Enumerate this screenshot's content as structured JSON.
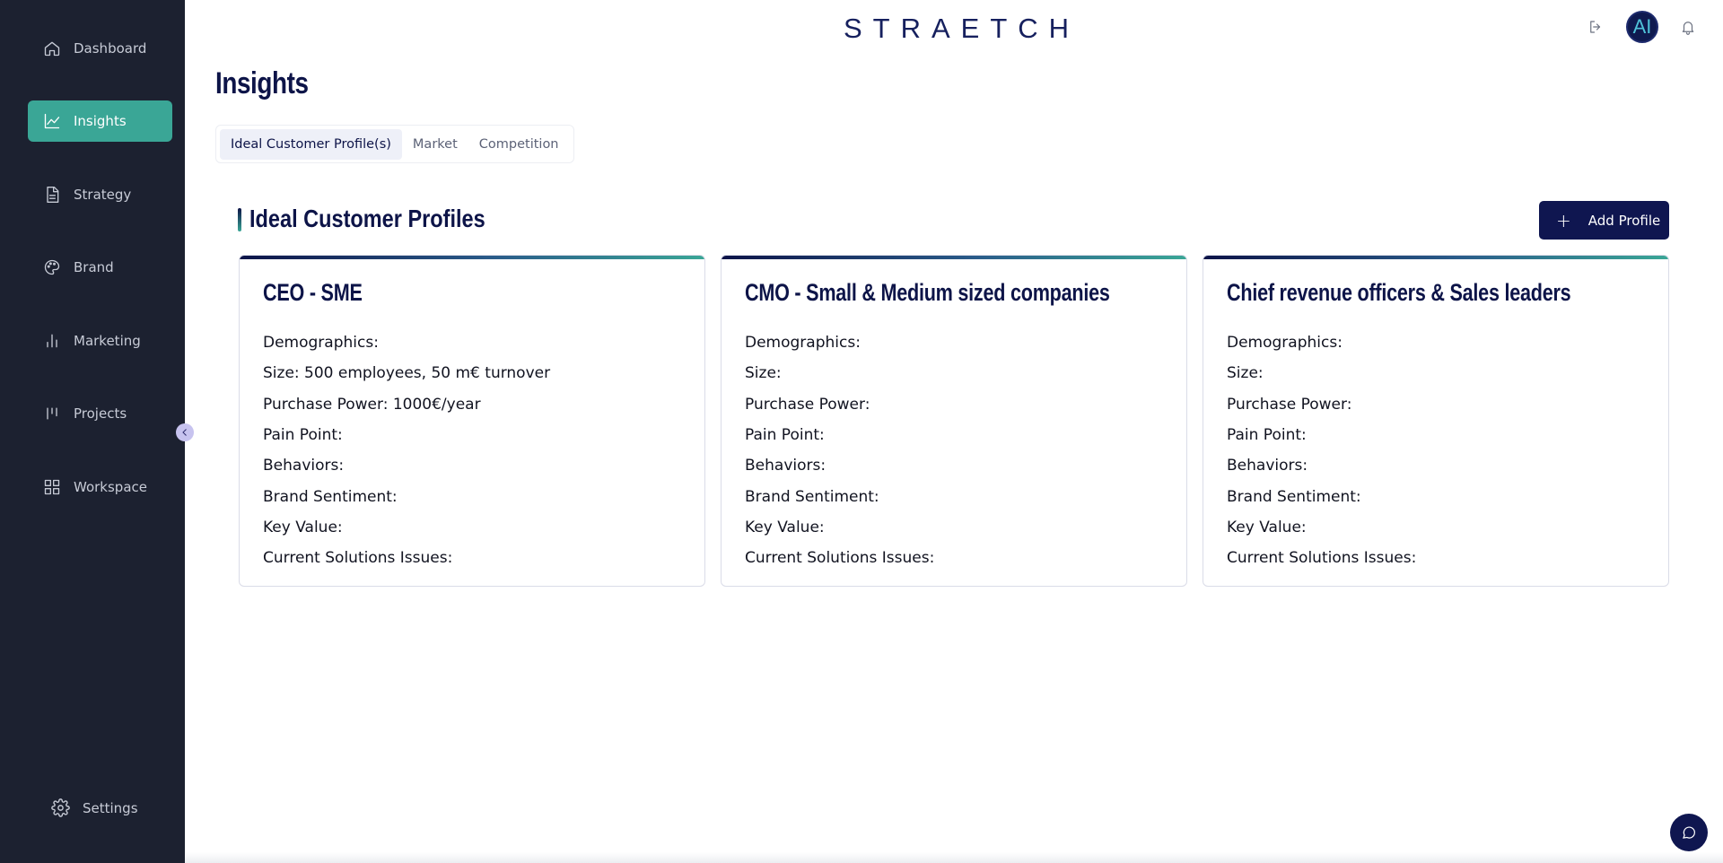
{
  "sidebar": {
    "items": [
      {
        "label": "Dashboard",
        "icon": "home-icon",
        "active": false
      },
      {
        "label": "Insights",
        "icon": "chart-line-icon",
        "active": true
      },
      {
        "label": "Strategy",
        "icon": "document-icon",
        "active": false
      },
      {
        "label": "Brand",
        "icon": "palette-icon",
        "active": false
      },
      {
        "label": "Marketing",
        "icon": "bar-chart-icon",
        "active": false
      },
      {
        "label": "Projects",
        "icon": "kanban-icon",
        "active": false
      },
      {
        "label": "Workspace",
        "icon": "grid-icon",
        "active": false
      }
    ],
    "settings_label": "Settings"
  },
  "header": {
    "logo": "STRAETCH",
    "avatar_initials": "AI"
  },
  "page": {
    "title": "Insights",
    "tabs": [
      {
        "label": "Ideal Customer Profile(s)",
        "active": true
      },
      {
        "label": "Market",
        "active": false
      },
      {
        "label": "Competition",
        "active": false
      }
    ],
    "section_title": "Ideal Customer Profiles",
    "add_button_label": "Add Profile"
  },
  "profiles": [
    {
      "title": "CEO - SME",
      "fields": [
        "Demographics:",
        "Size: 500 employees, 50 m€ turnover",
        "Purchase Power: 1000€/year",
        "Pain Point:",
        "Behaviors:",
        "Brand Sentiment:",
        "Key Value:",
        "Current Solutions Issues:"
      ]
    },
    {
      "title": "CMO - Small & Medium sized companies",
      "fields": [
        "Demographics:",
        "Size:",
        "Purchase Power:",
        "Pain Point:",
        "Behaviors:",
        "Brand Sentiment:",
        "Key Value:",
        "Current Solutions Issues:"
      ]
    },
    {
      "title": "Chief revenue officers & Sales leaders",
      "fields": [
        "Demographics:",
        "Size:",
        "Purchase Power:",
        "Pain Point:",
        "Behaviors:",
        "Brand Sentiment:",
        "Key Value:",
        "Current Solutions Issues:"
      ]
    }
  ],
  "colors": {
    "sidebar_bg": "#1c2130",
    "active_nav": "#3aa696",
    "primary": "#0f1650"
  }
}
